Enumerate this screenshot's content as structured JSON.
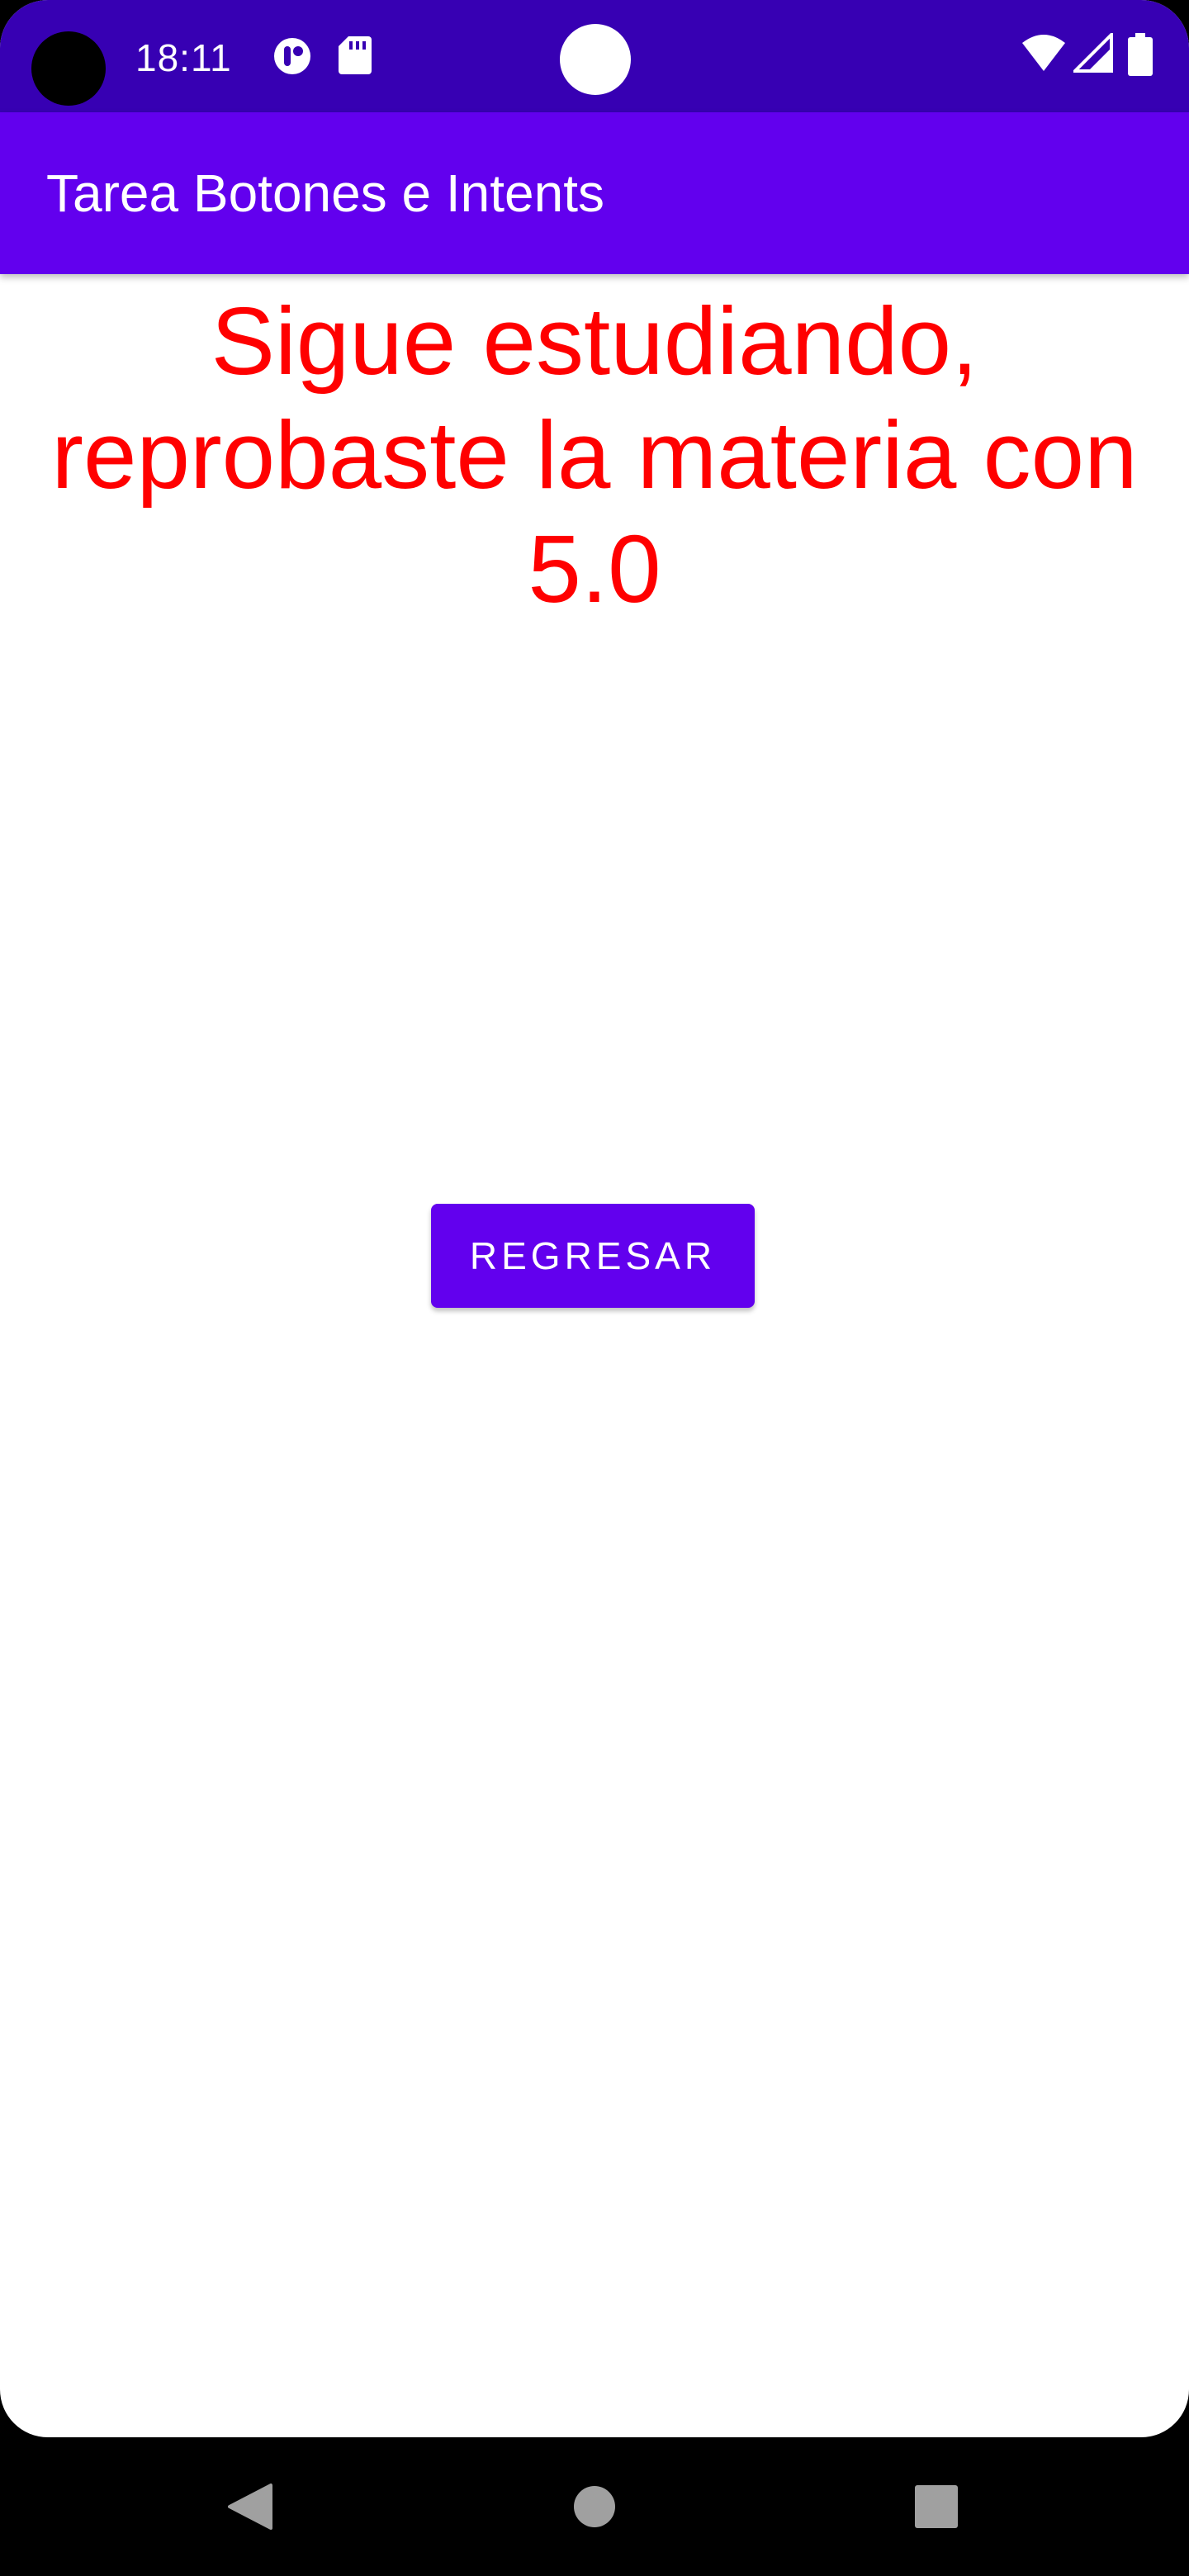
{
  "status_bar": {
    "time": "18:11",
    "icons": [
      "camera-cutout-icon",
      "alarm-app-icon",
      "sd-card-icon",
      "center-dot-icon",
      "wifi-icon",
      "signal-icon",
      "battery-icon"
    ],
    "background_color": "#3700b3"
  },
  "app_bar": {
    "title": "Tarea Botones e Intents",
    "background_color": "#6200ee"
  },
  "main": {
    "message": "Sigue estudiando, reprobaste la materia con 5.0",
    "message_color": "#ff0000",
    "button_label": "REGRESAR",
    "button_color": "#6200ee"
  },
  "nav_bar": {
    "icons": [
      "back-icon",
      "home-icon",
      "recents-icon"
    ]
  }
}
